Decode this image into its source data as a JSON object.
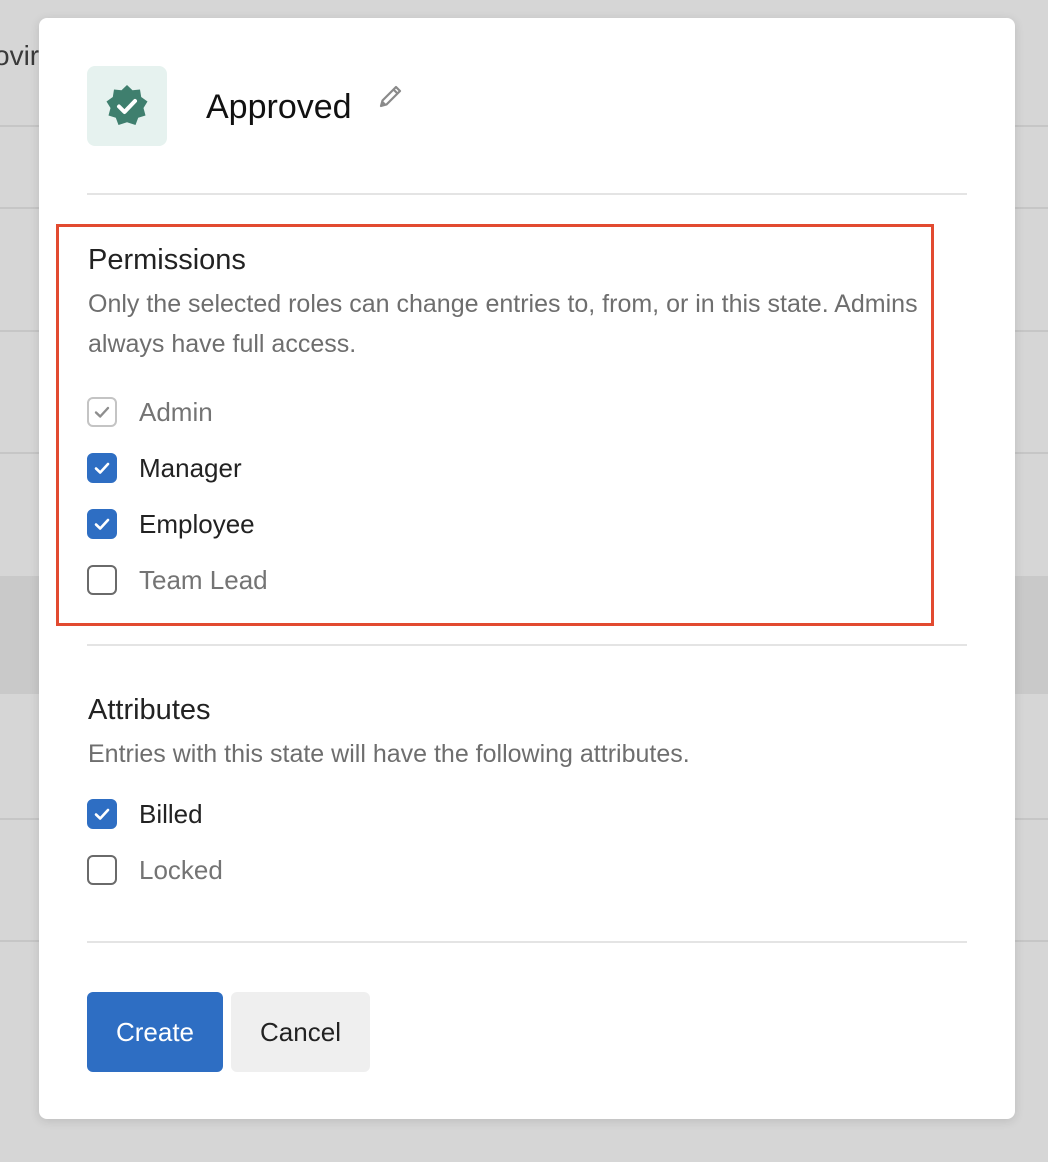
{
  "background": {
    "partial_text": "ovir"
  },
  "modal": {
    "state_name": "Approved",
    "icon": "verified-badge-icon",
    "edit_icon": "pencil-icon",
    "accent_color": "#2e6ec3",
    "badge_color": "#3f7f6e",
    "highlight_color": "#e24a30"
  },
  "permissions": {
    "title": "Permissions",
    "description": "Only the selected roles can change entries to, from, or in this state. Admins always have full access.",
    "roles": [
      {
        "label": "Admin",
        "checked": true,
        "disabled": true
      },
      {
        "label": "Manager",
        "checked": true,
        "disabled": false
      },
      {
        "label": "Employee",
        "checked": true,
        "disabled": false
      },
      {
        "label": "Team Lead",
        "checked": false,
        "disabled": false
      }
    ]
  },
  "attributes": {
    "title": "Attributes",
    "description": "Entries with this state will have the following attributes.",
    "items": [
      {
        "label": "Billed",
        "checked": true
      },
      {
        "label": "Locked",
        "checked": false
      }
    ]
  },
  "actions": {
    "create_label": "Create",
    "cancel_label": "Cancel"
  }
}
